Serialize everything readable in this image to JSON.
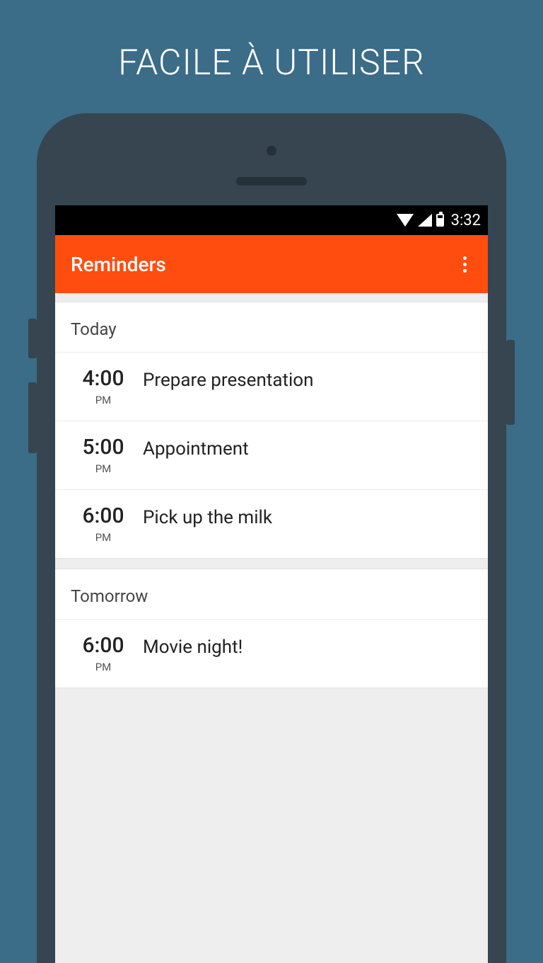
{
  "promo": {
    "headline": "FACILE À UTILISER"
  },
  "status": {
    "time": "3:32"
  },
  "appbar": {
    "title": "Reminders"
  },
  "sections": [
    {
      "label": "Today",
      "items": [
        {
          "time": "4:00",
          "ampm": "PM",
          "title": "Prepare presentation"
        },
        {
          "time": "5:00",
          "ampm": "PM",
          "title": "Appointment"
        },
        {
          "time": "6:00",
          "ampm": "PM",
          "title": "Pick up the milk"
        }
      ]
    },
    {
      "label": "Tomorrow",
      "items": [
        {
          "time": "6:00",
          "ampm": "PM",
          "title": "Movie night!"
        }
      ]
    }
  ]
}
